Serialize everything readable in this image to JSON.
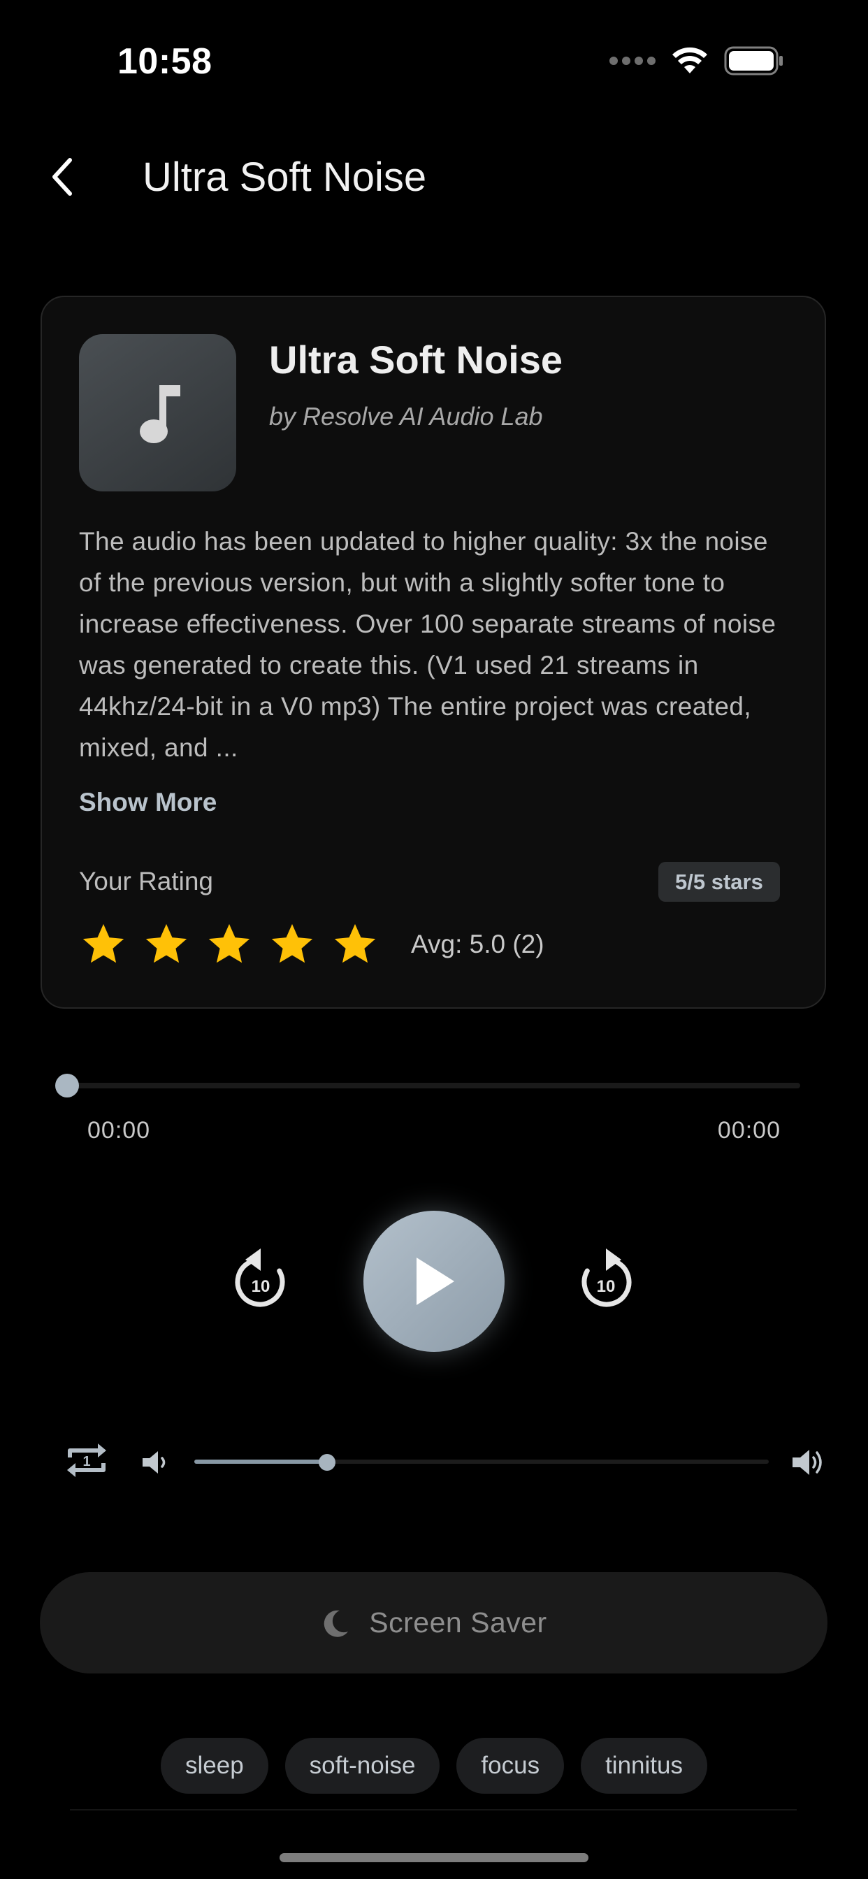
{
  "status_bar": {
    "time": "10:58"
  },
  "header": {
    "title": "Ultra Soft Noise"
  },
  "track": {
    "title": "Ultra Soft Noise",
    "artist": "by Resolve AI Audio Lab",
    "description": "The audio has been updated to higher quality: 3x the noise of the previous version, but with a slightly softer tone to increase effectiveness. Over 100 separate streams of noise was generated to create this. (V1 used 21 streams in 44khz/24-bit in a V0 mp3) The entire project was created, mixed, and ...",
    "show_more_label": "Show More"
  },
  "rating": {
    "label": "Your Rating",
    "badge": "5/5 stars",
    "stars_filled": 5,
    "stars_total": 5,
    "average_text": "Avg: 5.0 (2)",
    "star_color": "#FFC107"
  },
  "player": {
    "current_time": "00:00",
    "total_time": "00:00",
    "progress": 0,
    "skip_back_seconds": "10",
    "skip_forward_seconds": "10",
    "volume": 0.23,
    "accent_color": "#A7B4BF"
  },
  "screensaver": {
    "label": "Screen Saver"
  },
  "tags": [
    "sleep",
    "soft-noise",
    "focus",
    "tinnitus"
  ]
}
